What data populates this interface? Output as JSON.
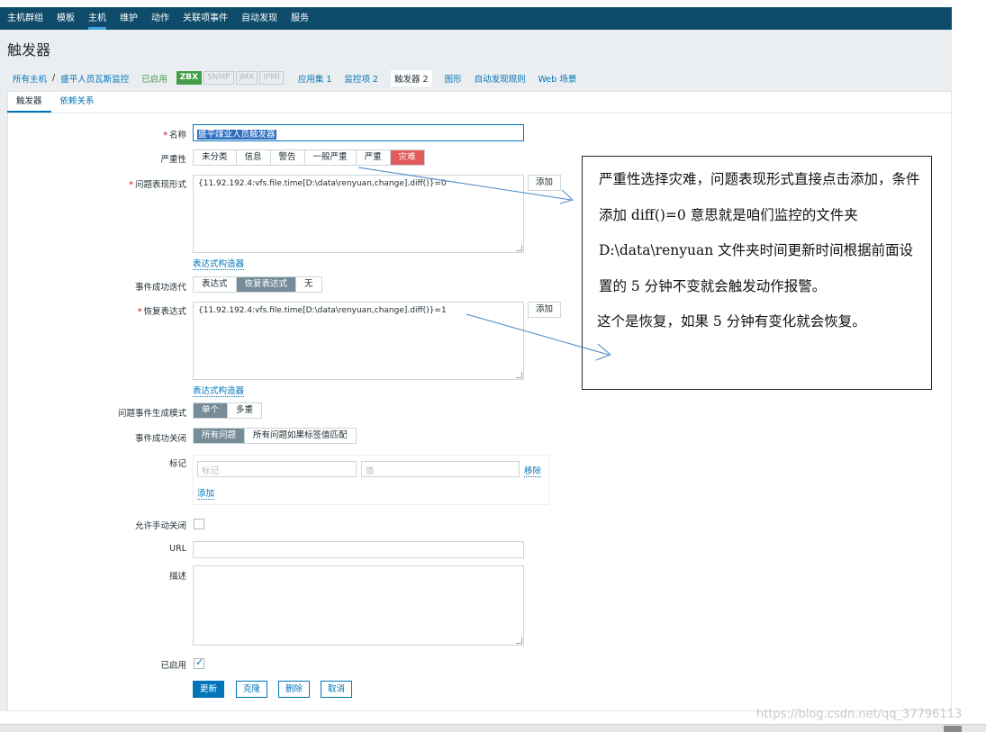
{
  "topnav": {
    "items": [
      "主机群组",
      "模板",
      "主机",
      "维护",
      "动作",
      "关联项事件",
      "自动发现",
      "服务"
    ],
    "active_index": 2
  },
  "page": {
    "title": "触发器"
  },
  "breadcrumb": {
    "all_hosts": "所有主机",
    "separator": "/",
    "host": "盛平人员瓦斯监控",
    "status": "已启用",
    "badges": [
      "ZBX",
      "SNMP",
      "JMX",
      "IPMI"
    ],
    "apps": "应用集 1",
    "items": "监控项 2",
    "triggers": "触发器 2",
    "graphs": "图形",
    "discovery": "自动发现规则",
    "web": "Web 场景"
  },
  "tabs": [
    "触发器",
    "依赖关系"
  ],
  "form": {
    "name_label": "名称",
    "name_value": "盛平煤业人员触发器",
    "severity_label": "严重性",
    "severity_options": [
      "未分类",
      "信息",
      "警告",
      "一般严重",
      "严重",
      "灾难"
    ],
    "severity_selected": "灾难",
    "problem_expr_label": "问题表现形式",
    "problem_expr_value": "{11.92.192.4:vfs.file.time[D:\\data\\renyuan,change].diff()}=0",
    "add_label": "添加",
    "expr_builder_label": "表达式构造器",
    "recovery_gen_label": "事件成功迭代",
    "recovery_gen_options": [
      "表达式",
      "恢复表达式",
      "无"
    ],
    "recovery_gen_selected": "恢复表达式",
    "recovery_expr_label": "恢复表达式",
    "recovery_expr_value": "{11.92.192.4:vfs.file.time[D:\\data\\renyuan,change].diff()}=1",
    "gen_mode_label": "问题事件生成模式",
    "gen_mode_options": [
      "单个",
      "多重"
    ],
    "gen_mode_selected": "单个",
    "close_label": "事件成功关闭",
    "close_options": [
      "所有问题",
      "所有问题如果标签值匹配"
    ],
    "close_selected": "所有问题",
    "tags_label": "标记",
    "tag_placeholder": "标记",
    "value_placeholder": "值",
    "remove_label": "移除",
    "tag_add_label": "添加",
    "manual_close_label": "允许手动关闭",
    "manual_close_checked": false,
    "url_label": "URL",
    "url_value": "",
    "desc_label": "描述",
    "desc_value": "",
    "enabled_label": "已启用",
    "enabled_checked": true
  },
  "buttons": {
    "update": "更新",
    "clone": "克隆",
    "delete": "删除",
    "cancel": "取消"
  },
  "annotation": {
    "para1": "严重性选择灾难，问题表现形式直接点击添加，条件添加 diff()=0 意思就是咱们监控的文件夹 D:\\data\\renyuan 文件夹时间更新时间根据前面设置的 5 分钟不变就会触发动作报警。",
    "para2": "这个是恢复，如果 5 分钟有变化就会恢复。"
  },
  "watermark": "https://blog.csdn.net/qq_37796113"
}
